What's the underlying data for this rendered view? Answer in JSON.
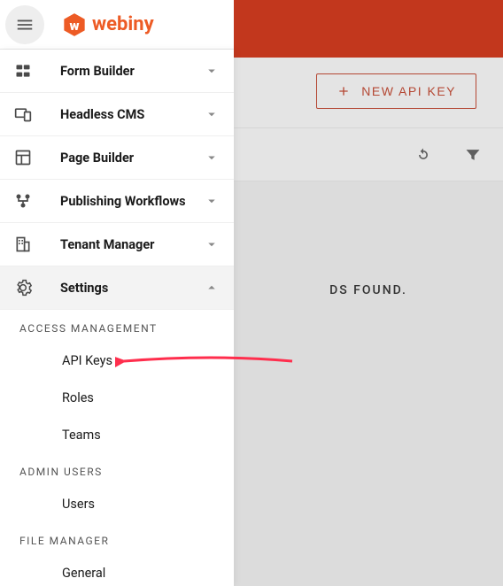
{
  "brand": {
    "name": "webiny"
  },
  "topbar": {
    "menu_label": "Main menu"
  },
  "header": {
    "new_key_label": "NEW API KEY"
  },
  "toolbar": {
    "refresh_label": "Refresh",
    "filter_label": "Filter"
  },
  "empty": {
    "message": "DS FOUND."
  },
  "sidebar": {
    "items": [
      {
        "label": "Form Builder"
      },
      {
        "label": "Headless CMS"
      },
      {
        "label": "Page Builder"
      },
      {
        "label": "Publishing Workflows"
      },
      {
        "label": "Tenant Manager"
      },
      {
        "label": "Settings"
      }
    ],
    "sections": {
      "access_mgmt": {
        "header": "ACCESS MANAGEMENT",
        "items": [
          {
            "label": "API Keys"
          },
          {
            "label": "Roles"
          },
          {
            "label": "Teams"
          }
        ]
      },
      "admin_users": {
        "header": "ADMIN USERS",
        "items": [
          {
            "label": "Users"
          }
        ]
      },
      "file_manager": {
        "header": "FILE MANAGER",
        "items": [
          {
            "label": "General"
          }
        ]
      }
    }
  }
}
